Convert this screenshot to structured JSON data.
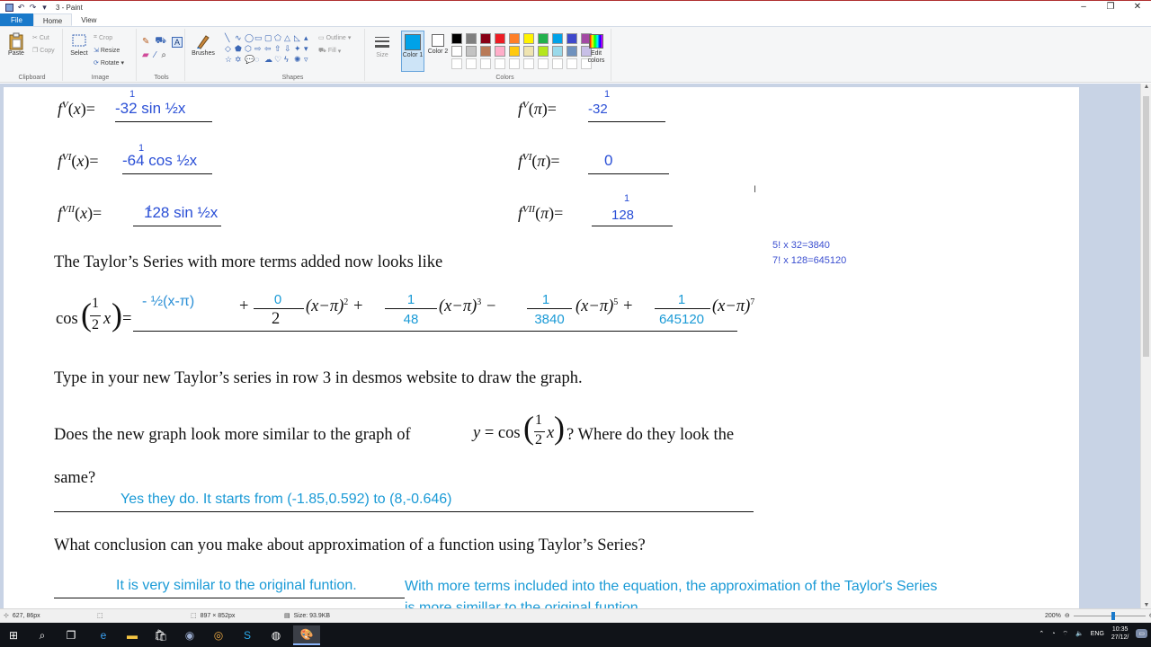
{
  "window": {
    "title": "3 - Paint"
  },
  "tabs": [
    {
      "label": "File"
    },
    {
      "label": "Home"
    },
    {
      "label": "View"
    }
  ],
  "ribbon": {
    "clipboard": {
      "label": "Clipboard",
      "paste": "Paste",
      "cut": "Cut",
      "copy": "Copy"
    },
    "image": {
      "label": "Image",
      "select": "Select",
      "crop": "Crop",
      "resize": "Resize",
      "rotate": "Rotate"
    },
    "tools": {
      "label": "Tools"
    },
    "brushes": {
      "label": "Brushes"
    },
    "shapes": {
      "label": "Shapes",
      "outline": "Outline",
      "fill": "Fill"
    },
    "size": {
      "label": "Size"
    },
    "colors": {
      "label": "Colors",
      "color1": "Color 1",
      "color2": "Color 2",
      "edit": "Edit colors",
      "palette_row1": [
        "#000000",
        "#7f7f7f",
        "#880015",
        "#ed1c24",
        "#ff7f27",
        "#fff200",
        "#22b14c",
        "#00a2e8",
        "#3f48cc",
        "#a349a4"
      ],
      "palette_row2": [
        "#ffffff",
        "#c3c3c3",
        "#b97a57",
        "#ffaec9",
        "#ffc90e",
        "#efe4b0",
        "#b5e61d",
        "#99d9ea",
        "#7092be",
        "#c8bfe7"
      ]
    }
  },
  "doc": {
    "rows": [
      {
        "lhs_sup": "V",
        "lhs_hand_num": "1",
        "lhs_hand": "-32 sin ½x",
        "rhs_sup": "V",
        "rhs_hand_num": "1",
        "rhs_hand": "-32"
      },
      {
        "lhs_sup": "VI",
        "lhs_hand_num": "1",
        "lhs_hand": "-64 cos ½x",
        "rhs_sup": "VI",
        "rhs_hand_num": "",
        "rhs_hand": "0"
      },
      {
        "lhs_sup": "VII",
        "lhs_hand_num": "1",
        "lhs_hand": "128 sin ½x",
        "rhs_sup": "VII",
        "rhs_hand_num": "1",
        "rhs_hand": "128"
      }
    ],
    "notes": [
      "5! x 32=3840",
      "7! x 128=645120"
    ],
    "taylor_heading": "The Taylor’s Series with more terms added now looks like",
    "series": {
      "lhs": "cos",
      "lhs_num": "1",
      "lhs_den": "2",
      "t1": "- ½(x-π)",
      "t2_num": "0",
      "t2_den": "2",
      "t3_num": "1",
      "t3_den": "48",
      "t4_num": "1",
      "t4_den": "3840",
      "t5_num": "1",
      "t5_den": "645120"
    },
    "q_type": "Type in your new Taylor’s series in row 3 in desmos website to draw the graph.",
    "q_similar_a": "Does the new graph look more similar to the graph of",
    "q_similar_b": "? Where do they look the",
    "q_similar_c": "same?",
    "answer1": "Yes they do. It starts from (-1.85,0.592) to (8,-0.646)",
    "q_conclusion": "What conclusion can you make about approximation of a function using Taylor’s Series?",
    "answer2a": "It is very similar to the original funtion.",
    "answer2b": "With more terms included into the equation, the approximation of the Taylor's Series",
    "answer2c": "is more simillar to the original funtion."
  },
  "status": {
    "cursor": "627, 86px",
    "selection": "",
    "dimensions": "897 × 852px",
    "size": "Size: 93.9KB",
    "zoom": "200%"
  },
  "taskbar": {
    "lang": "ENG",
    "time": "10:35",
    "date": "27/12/"
  }
}
